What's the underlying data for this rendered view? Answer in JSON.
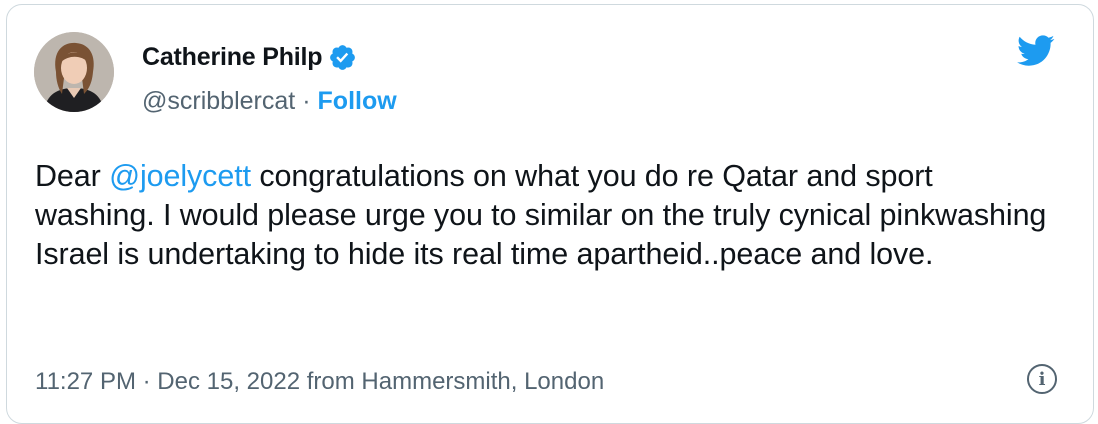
{
  "author": {
    "display_name": "Catherine Philp",
    "handle": "@scribblercat",
    "separator": "·",
    "follow_label": "Follow"
  },
  "tweet": {
    "text_before": "Dear ",
    "mention": "@joelycett",
    "text_after": " congratulations on what you do re Qatar and sport washing. I would please urge you to similar on the truly cynical pinkwashing Israel is undertaking to hide its real time apartheid..peace and love."
  },
  "meta": {
    "time": "11:27 PM",
    "separator": " · ",
    "date": "Dec 15, 2022",
    "location": " from Hammersmith, London"
  },
  "icons": {
    "verified": "verified-badge-icon",
    "brand": "twitter-bird-icon",
    "info": "info-icon"
  },
  "colors": {
    "accent": "#1d9bf0",
    "text": "#0f1419",
    "muted": "#536471",
    "border": "#cfd9de"
  }
}
